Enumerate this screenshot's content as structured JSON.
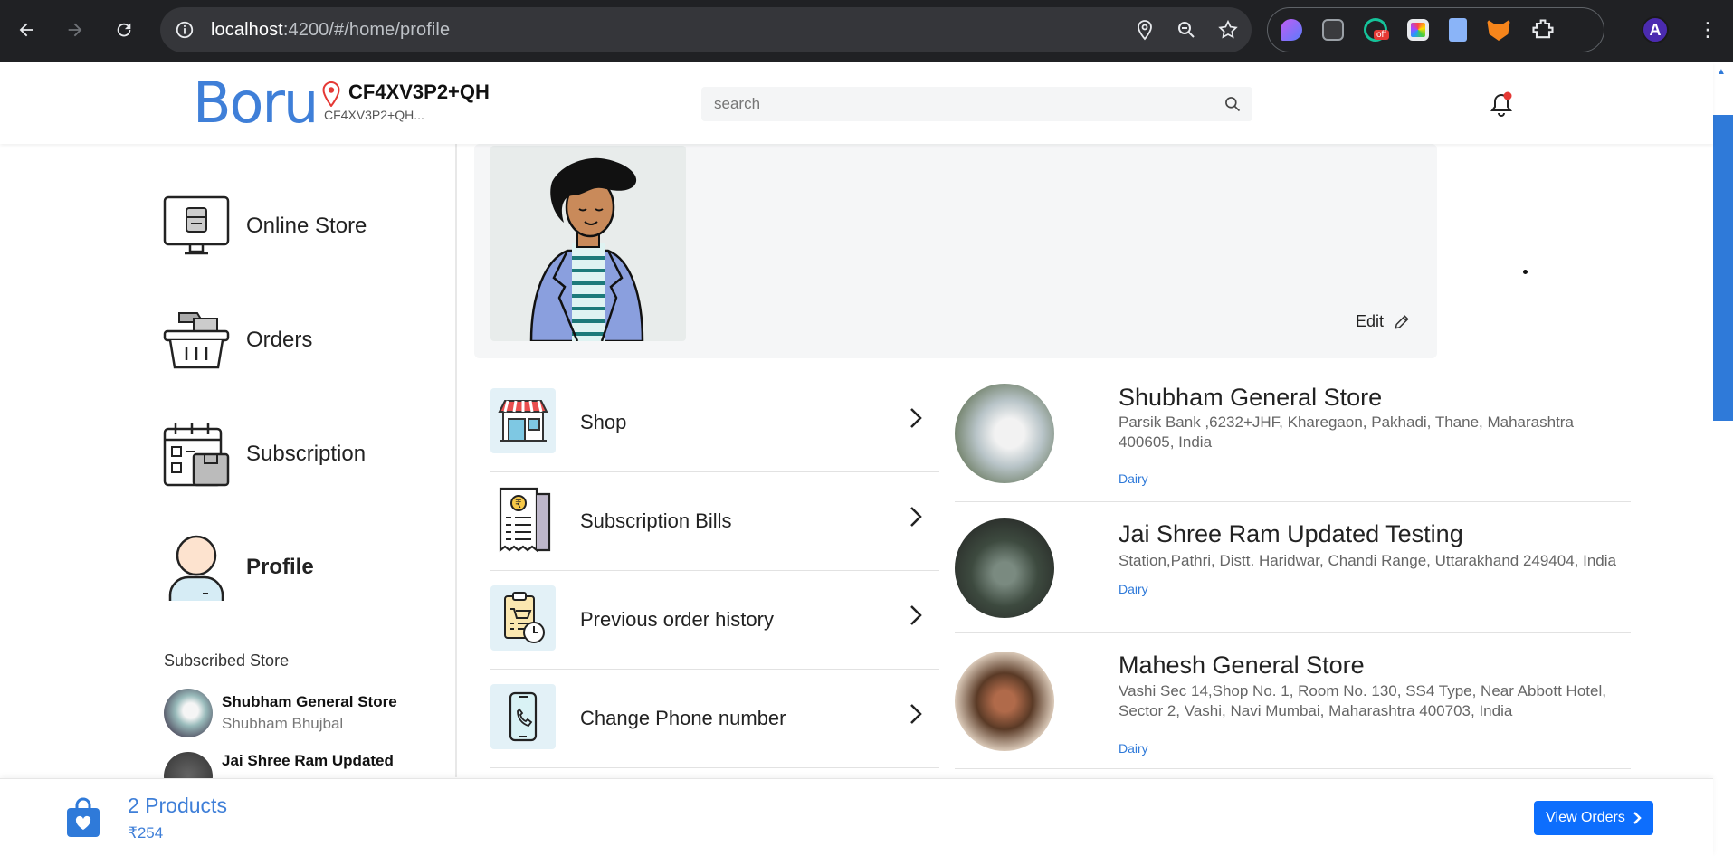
{
  "browser": {
    "url_host": "localhost",
    "url_path": ":4200/#/home/profile",
    "icons": [
      "back-icon",
      "forward-icon",
      "reload-icon",
      "site-info-icon",
      "location-icon",
      "zoom-icon",
      "bookmark-star-icon",
      "extensions-icon",
      "menu-icon"
    ],
    "ext_badge": "off",
    "profile_initial": "A"
  },
  "header": {
    "logo": "Boru",
    "location_title": "CF4XV3P2+QH",
    "location_sub": "CF4XV3P2+QH...",
    "search_placeholder": "search"
  },
  "sidebar": {
    "items": [
      {
        "label": "Online Store",
        "icon": "online-store-icon"
      },
      {
        "label": "Orders",
        "icon": "orders-basket-icon"
      },
      {
        "label": "Subscription",
        "icon": "subscription-calendar-icon"
      },
      {
        "label": "Profile",
        "icon": "profile-person-icon",
        "active": true
      }
    ],
    "subscribed_title": "Subscribed Store",
    "subscribed": [
      {
        "name": "Shubham General Store",
        "owner": "Shubham Bhujbal"
      },
      {
        "name": "Jai Shree Ram Updated",
        "owner": ""
      }
    ]
  },
  "profile": {
    "edit_label": "Edit"
  },
  "menu": [
    {
      "label": "Shop",
      "icon": "shop-icon"
    },
    {
      "label": "Subscription Bills",
      "icon": "bill-receipt-icon"
    },
    {
      "label": "Previous order history",
      "icon": "order-history-icon"
    },
    {
      "label": "Change Phone number",
      "icon": "phone-icon"
    }
  ],
  "stores": [
    {
      "name": "Shubham General Store",
      "address": "Parsik Bank ,6232+JHF, Kharegaon, Pakhadi, Thane, Maharashtra 400605, India",
      "category": "Dairy"
    },
    {
      "name": "Jai Shree Ram Updated Testing",
      "address": "Station,Pathri, Distt. Haridwar, Chandi Range, Uttarakhand 249404, India",
      "category": "Dairy"
    },
    {
      "name": "Mahesh General Store",
      "address": "Vashi Sec 14,Shop No. 1, Room No. 130, SS4 Type, Near Abbott Hotel, Sector 2, Vashi, Navi Mumbai, Maharashtra 400703, India",
      "category": "Dairy"
    }
  ],
  "cart": {
    "count_label": "2 Products",
    "price": "₹254",
    "view_orders_label": "View Orders"
  },
  "colors": {
    "brand": "#3f7fd8",
    "button": "#0d6efd",
    "chrome_bg": "#202124"
  }
}
